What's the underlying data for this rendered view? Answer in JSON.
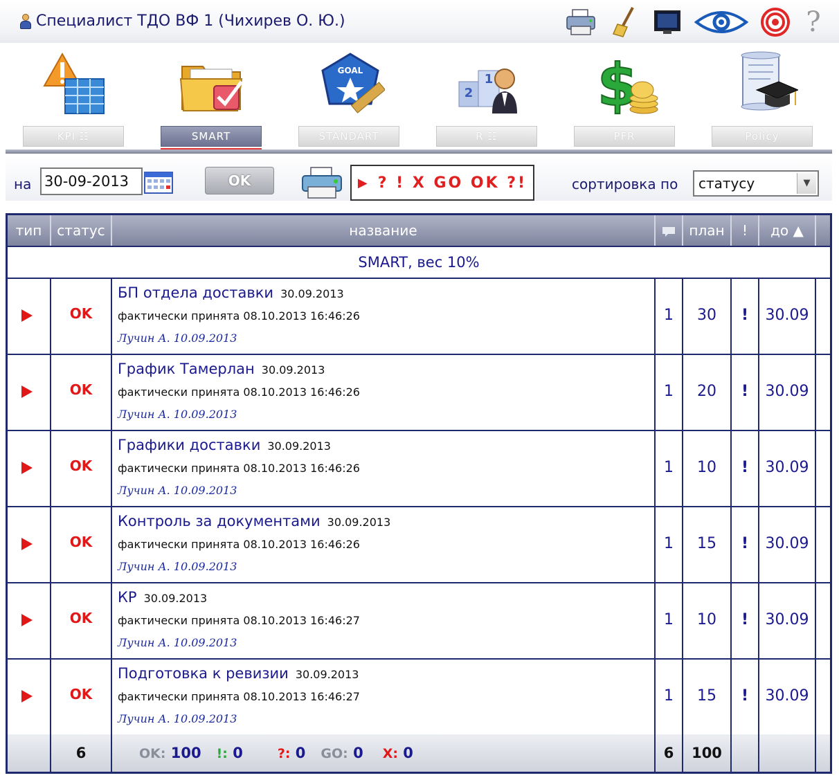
{
  "header": {
    "user_name": "Специалист ТДО ВФ 1  (Чихирев О. Ю.)",
    "tools": [
      "printer-icon",
      "broom-icon",
      "monitor-icon",
      "eye-icon",
      "target-icon",
      "help-icon"
    ],
    "help_glyph": "?"
  },
  "modules": [
    {
      "label": "KPI  ☷",
      "icon": "kpi-warning-table-icon"
    },
    {
      "label": "SMART",
      "icon": "folder-check-icon"
    },
    {
      "label": "STANDART",
      "icon": "goal-badge-ruler-icon"
    },
    {
      "label": "R  ☷",
      "icon": "podium-person-icon"
    },
    {
      "label": "PFR",
      "icon": "dollar-coins-icon"
    },
    {
      "label": "Policy",
      "icon": "scroll-graduation-cap-icon"
    }
  ],
  "toolbar": {
    "date_label": "на",
    "date_value": "30-09-2013",
    "ok_label": "OK",
    "status_filter": "? ! X GO OK ?!",
    "status_arrow": "▶",
    "sort_label": "сортировка по",
    "sort_value": "статусу",
    "sort_arrow": "▼"
  },
  "table": {
    "columns": [
      "тип",
      "статус",
      "название",
      "",
      "план",
      "!",
      "до ▲"
    ],
    "group": "SMART, вес 10%",
    "rows": [
      {
        "status": "OK",
        "title": "БП отдела доставки",
        "date": "30.09.2013",
        "fact": "фактически принята 08.10.2013 16:46:26",
        "author": "Лучин А. 10.09.2013",
        "count": "1",
        "plan": "30",
        "flag": "!",
        "due": "30.09"
      },
      {
        "status": "OK",
        "title": "График Тамерлан",
        "date": "30.09.2013",
        "fact": "фактически принята 08.10.2013 16:46:26",
        "author": "Лучин А. 10.09.2013",
        "count": "1",
        "plan": "20",
        "flag": "!",
        "due": "30.09"
      },
      {
        "status": "OK",
        "title": "Графики доставки",
        "date": "30.09.2013",
        "fact": "фактически принята 08.10.2013 16:46:26",
        "author": "Лучин А. 10.09.2013",
        "count": "1",
        "plan": "10",
        "flag": "!",
        "due": "30.09"
      },
      {
        "status": "OK",
        "title": "Контроль за документами",
        "date": "30.09.2013",
        "fact": "фактически принята 08.10.2013 16:46:26",
        "author": "Лучин А. 10.09.2013",
        "count": "1",
        "plan": "15",
        "flag": "!",
        "due": "30.09"
      },
      {
        "status": "OK",
        "title": "КР",
        "date": "30.09.2013",
        "fact": "фактически принята 08.10.2013 16:46:27",
        "author": "Лучин А. 10.09.2013",
        "count": "1",
        "plan": "10",
        "flag": "!",
        "due": "30.09"
      },
      {
        "status": "OK",
        "title": "Подготовка к ревизии",
        "date": "30.09.2013",
        "fact": "фактически принята 08.10.2013 16:46:27",
        "author": "Лучин А. 10.09.2013",
        "count": "1",
        "plan": "15",
        "flag": "!",
        "due": "30.09"
      }
    ],
    "footer": {
      "status_count": "6",
      "ok_key": "OK:",
      "ok_val": "100",
      "excl_key": "!:",
      "excl_val": "0",
      "q_key": "?:",
      "q_val": "0",
      "go_key": "GO:",
      "go_val": "0",
      "x_key": "X:",
      "x_val": "0",
      "count_total": "6",
      "plan_total": "100"
    }
  },
  "colors": {
    "text": "#1a1a8e",
    "ok_status": "#e01818",
    "table_border": "#1f2a6e",
    "active_tab_underline": "#e03434"
  }
}
